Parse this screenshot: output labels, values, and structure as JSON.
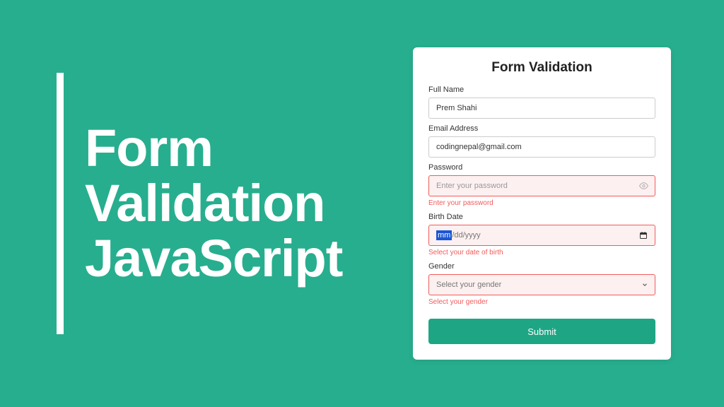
{
  "headline": "Form\nValidation\nJavaScript",
  "form": {
    "title": "Form Validation",
    "fields": {
      "fullName": {
        "label": "Full Name",
        "value": "Prem Shahi"
      },
      "email": {
        "label": "Email Address",
        "value": "codingnepal@gmail.com"
      },
      "password": {
        "label": "Password",
        "placeholder": "Enter your password",
        "error": "Enter your password"
      },
      "birthDate": {
        "label": "Birth Date",
        "segment_selected": "mm",
        "rest": "/dd/yyyy",
        "error": "Select your date of birth"
      },
      "gender": {
        "label": "Gender",
        "placeholder": "Select your gender",
        "error": "Select your gender"
      }
    },
    "submit": "Submit"
  }
}
